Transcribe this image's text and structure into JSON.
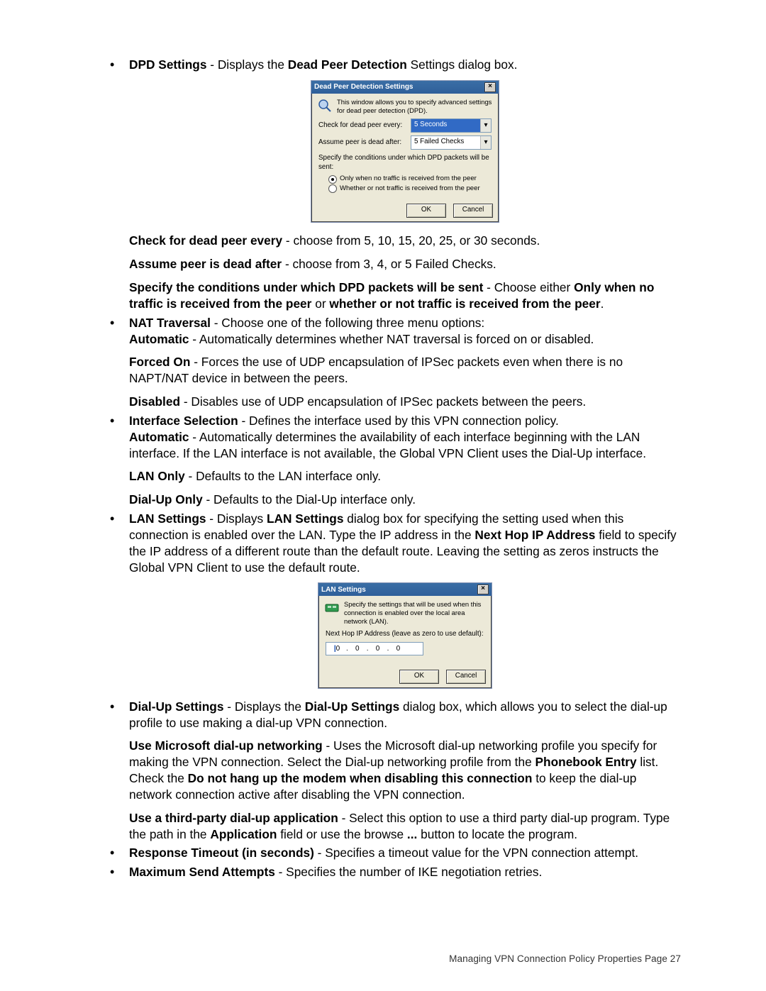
{
  "bullets": {
    "dpd": {
      "lead_b1": "DPD Settings",
      "lead_t1": " - Displays the ",
      "lead_b2": "Dead Peer Detection",
      "lead_t2": " Settings dialog box."
    },
    "dpd_check": {
      "b": "Check for dead peer every",
      "t": " - choose from 5, 10, 15, 20, 25, or 30 seconds."
    },
    "dpd_assume": {
      "b": "Assume peer is dead after",
      "t": " - choose from 3, 4, or 5 Failed Checks."
    },
    "dpd_cond": {
      "b1": "Specify the conditions under which DPD packets will be sent",
      "t1": " - Choose either ",
      "b2": "Only when no traffic is received from the peer",
      "t2": " or ",
      "b3": "whether or not traffic is received from the peer",
      "t3": "."
    },
    "nat": {
      "b1": "NAT Traversal",
      "t1": " - Choose one of the following three menu options:",
      "auto_b": "Automatic",
      "auto_t": " - Automatically determines whether NAT traversal is forced on or disabled.",
      "forced_b": "Forced On",
      "forced_t": " - Forces the use of UDP encapsulation of IPSec packets even when there is no NAPT/NAT device in between the peers.",
      "dis_b": "Disabled",
      "dis_t": " - Disables use of UDP encapsulation of IPSec packets between the peers."
    },
    "iface": {
      "b1": "Interface Selection",
      "t1": " - Defines the interface used by this VPN connection policy.",
      "auto_b": "Automatic",
      "auto_t": " - Automatically determines the availability of each interface beginning with the LAN interface. If the LAN interface is not available, the Global VPN Client uses the Dial-Up interface.",
      "lan_b": "LAN Only",
      "lan_t": " - Defaults to the LAN interface only.",
      "dial_b": "Dial-Up Only",
      "dial_t": " - Defaults to the Dial-Up interface only."
    },
    "lan": {
      "b1": "LAN Settings",
      "t1": " - Displays ",
      "b2": "LAN Settings",
      "t2": " dialog box for specifying the setting used when this connection is enabled over the LAN. Type the IP address in the ",
      "b3": "Next Hop IP Address",
      "t3": " field to specify the IP address of a different route than the default route. Leaving the setting as zeros instructs the Global VPN Client to use the default route."
    },
    "dialup": {
      "b1": "Dial-Up Settings",
      "t1": " - Displays the ",
      "b2": "Dial-Up Settings",
      "t2": " dialog box, which allows you to select the dial-up profile to use making a dial-up VPN connection.",
      "ms_b": "Use Microsoft dial-up networking",
      "ms_t1": " - Uses the Microsoft dial-up networking profile you specify for making the VPN connection. Select the Dial-up networking profile from the ",
      "ms_b2": "Phonebook Entry",
      "ms_t2": " list. Check the ",
      "ms_b3": "Do not hang up the modem when disabling this connection",
      "ms_t3": " to keep the dial-up network connection active after disabling the VPN connection.",
      "tp_b": "Use a third-party dial-up application",
      "tp_t1": " - Select this option to use a third party dial-up program. Type the path in the ",
      "tp_b2": "Application",
      "tp_t2": " field or use the browse ",
      "tp_b3": "...",
      "tp_t3": " button to locate the program."
    },
    "resp": {
      "b": "Response Timeout (in seconds)",
      "t": " - Specifies a timeout value for the VPN connection attempt."
    },
    "max": {
      "b": "Maximum Send Attempts",
      "t": " - Specifies the number of IKE negotiation retries."
    }
  },
  "dpd_dialog": {
    "title": "Dead Peer Detection Settings",
    "desc": "This window allows you to specify advanced settings for dead peer detection (DPD).",
    "row1_label": "Check for dead peer every:",
    "row1_value": "5 Seconds",
    "row2_label": "Assume peer is dead after:",
    "row2_value": "5 Failed Checks",
    "conditions_title": "Specify the conditions under which DPD packets will be sent:",
    "opt1": "Only when no traffic is received from the peer",
    "opt2": "Whether or not traffic is received from the peer",
    "ok": "OK",
    "cancel": "Cancel",
    "close": "×"
  },
  "lan_dialog": {
    "title": "LAN Settings",
    "desc": "Specify the settings that will be used when this connection is enabled over the local area network (LAN).",
    "nexthop_label": "Next Hop IP Address (leave as zero to use default):",
    "ip": [
      "0",
      "0",
      "0",
      "0"
    ],
    "ok": "OK",
    "cancel": "Cancel",
    "close": "×"
  },
  "footer": {
    "text": "Managing VPN Connection Policy Properties Page 27"
  }
}
